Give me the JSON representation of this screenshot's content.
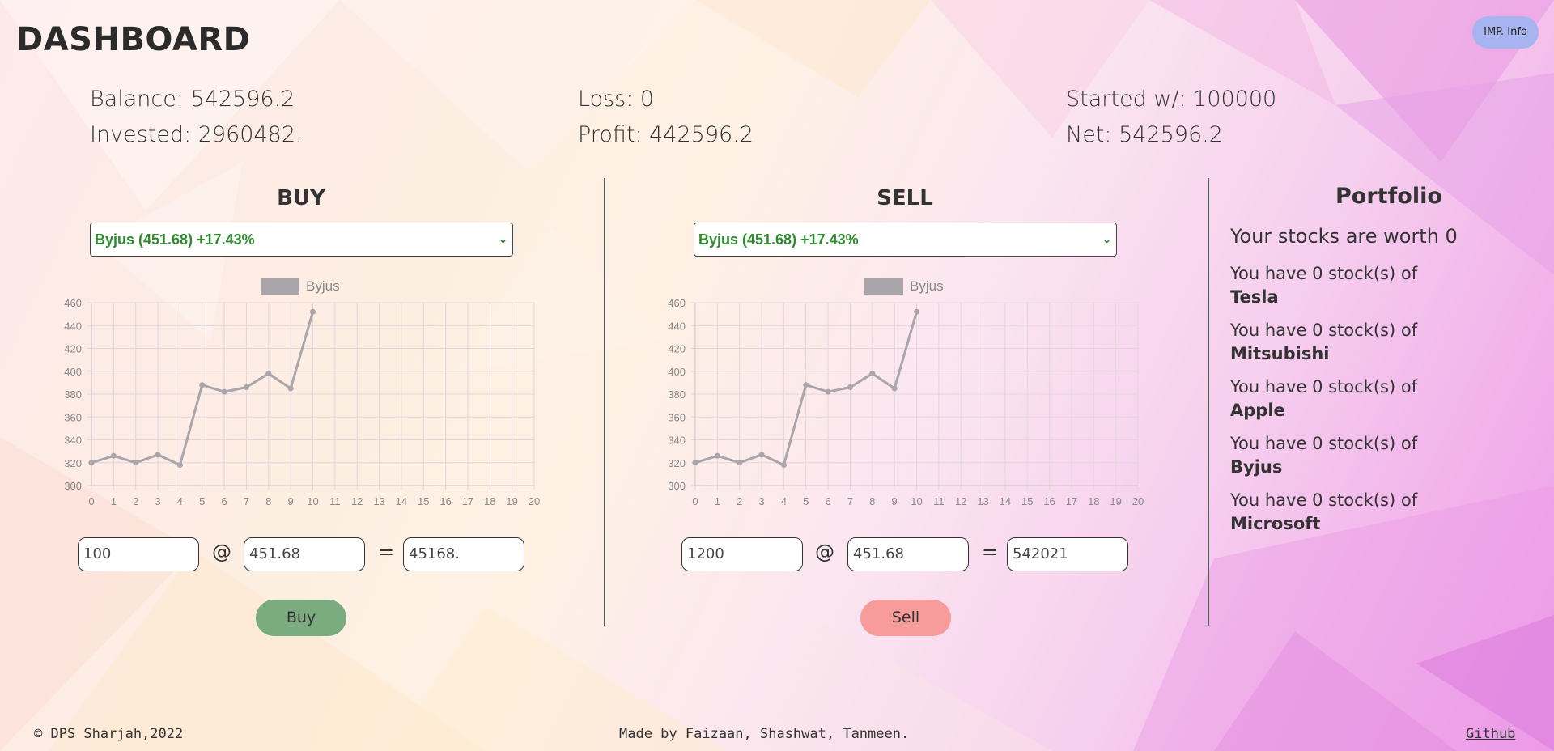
{
  "header": {
    "title": "DASHBOARD",
    "info_button": "IMP. Info"
  },
  "stats": {
    "balance": "Balance: 542596.2",
    "invested": "Invested: 2960482.",
    "loss": "Loss: 0",
    "profit": "Profit: 442596.2",
    "started": "Started w/: 100000",
    "net": "Net: 542596.2"
  },
  "buy": {
    "heading": "BUY",
    "selected_stock": "Byjus (451.68) +17.43%",
    "quantity": "100",
    "at": "@",
    "price": "451.68",
    "equals": "=",
    "total": "45168.",
    "button": "Buy",
    "button_color": "#7aac7f"
  },
  "sell": {
    "heading": "SELL",
    "selected_stock": "Byjus (451.68) +17.43%",
    "quantity": "1200",
    "at": "@",
    "price": "451.68",
    "equals": "=",
    "total": "542021",
    "button": "Sell",
    "button_color": "#f79b9b"
  },
  "chart_data": [
    {
      "type": "line",
      "legend": "Byjus",
      "x": [
        0,
        1,
        2,
        3,
        4,
        5,
        6,
        7,
        8,
        9,
        10
      ],
      "values": [
        320,
        326,
        320,
        327,
        318,
        388,
        382,
        386,
        398,
        385,
        452
      ],
      "x_ticks": [
        "0",
        "1",
        "2",
        "3",
        "4",
        "5",
        "6",
        "7",
        "8",
        "9",
        "10",
        "11",
        "12",
        "13",
        "14",
        "15",
        "16",
        "17",
        "18",
        "19",
        "20"
      ],
      "y_ticks": [
        "300",
        "320",
        "340",
        "360",
        "380",
        "400",
        "420",
        "440",
        "460"
      ],
      "xlim": [
        0,
        20
      ],
      "ylim": [
        300,
        460
      ],
      "grid": true,
      "line_color": "#a9a5ab"
    },
    {
      "type": "line",
      "legend": "Byjus",
      "x": [
        0,
        1,
        2,
        3,
        4,
        5,
        6,
        7,
        8,
        9,
        10
      ],
      "values": [
        320,
        326,
        320,
        327,
        318,
        388,
        382,
        386,
        398,
        385,
        452
      ],
      "x_ticks": [
        "0",
        "1",
        "2",
        "3",
        "4",
        "5",
        "6",
        "7",
        "8",
        "9",
        "10",
        "11",
        "12",
        "13",
        "14",
        "15",
        "16",
        "17",
        "18",
        "19",
        "20"
      ],
      "y_ticks": [
        "300",
        "320",
        "340",
        "360",
        "380",
        "400",
        "420",
        "440",
        "460"
      ],
      "xlim": [
        0,
        20
      ],
      "ylim": [
        300,
        460
      ],
      "grid": true,
      "line_color": "#a9a5ab"
    }
  ],
  "portfolio": {
    "title": "Portfolio",
    "worth": "Your stocks are worth 0",
    "holdings": [
      {
        "text": "You have 0 stock(s) of",
        "name": "Tesla"
      },
      {
        "text": "You have 0 stock(s) of",
        "name": "Mitsubishi"
      },
      {
        "text": "You have 0 stock(s) of",
        "name": "Apple"
      },
      {
        "text": "You have 0 stock(s) of",
        "name": "Byjus"
      },
      {
        "text": "You have 0 stock(s) of",
        "name": "Microsoft"
      }
    ]
  },
  "footer": {
    "copyright": "© DPS Sharjah,2022",
    "credits": "Made by Faizaan, Shashwat, Tanmeen.",
    "github": "Github"
  }
}
